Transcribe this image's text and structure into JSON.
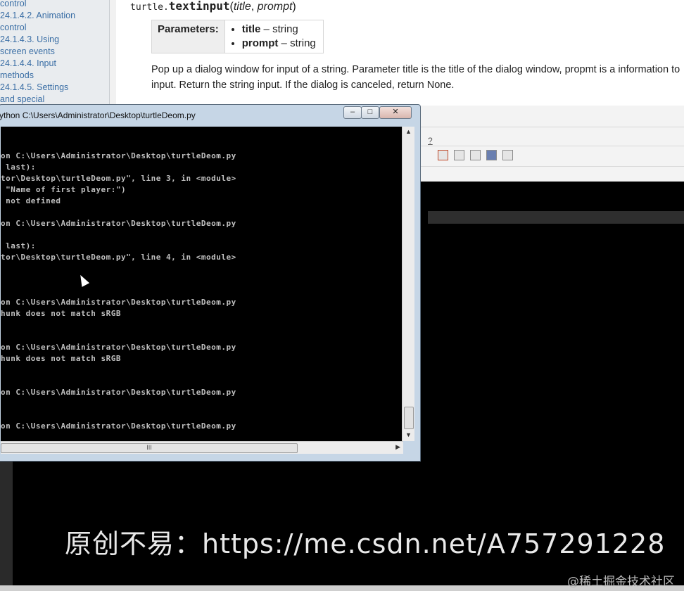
{
  "doc": {
    "toc": [
      "control",
      "24.1.4.2. Animation",
      "control",
      "24.1.4.3. Using",
      "screen events",
      "24.1.4.4. Input",
      "methods",
      "24.1.4.5. Settings",
      "and special"
    ],
    "signature": {
      "module": "turtle.",
      "function": "textinput",
      "open": "(",
      "arg1": "title",
      "sep": ", ",
      "arg2": "prompt",
      "close": ")"
    },
    "params_header": "Parameters:",
    "params": [
      {
        "name": "title",
        "type": " – string"
      },
      {
        "name": "prompt",
        "type": " – string"
      }
    ],
    "description": "Pop up a dialog window for input of a string. Parameter title is the title of the dialog window, propmt is a information to input. Return the string input. If the dialog is canceled, return None."
  },
  "ide": {
    "help_text": "?"
  },
  "console": {
    "title": "ython  C:\\Users\\Administrator\\Desktop\\turtleDeom.py",
    "minimize": "–",
    "maximize": "□",
    "close": "✕",
    "lines": [
      "on C:\\Users\\Administrator\\Desktop\\turtleDeom.py",
      " last):",
      "tor\\Desktop\\turtleDeom.py\", line 3, in <module>",
      " \"Name of first player:\")",
      " not defined",
      "on C:\\Users\\Administrator\\Desktop\\turtleDeom.py",
      " last):",
      "tor\\Desktop\\turtleDeom.py\", line 4, in <module>",
      "on C:\\Users\\Administrator\\Desktop\\turtleDeom.py",
      "hunk does not match sRGB",
      "on C:\\Users\\Administrator\\Desktop\\turtleDeom.py",
      "hunk does not match sRGB",
      "on C:\\Users\\Administrator\\Desktop\\turtleDeom.py",
      "on C:\\Users\\Administrator\\Desktop\\turtleDeom.py"
    ],
    "hscroll_grip": "III"
  },
  "overlay": {
    "watermark": "原创不易：https://me.csdn.net/A757291228",
    "corner": "@稀土掘金技术社区"
  }
}
